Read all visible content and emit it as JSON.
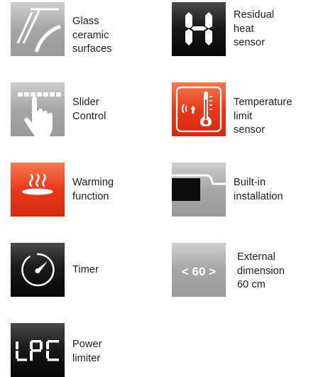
{
  "features": [
    {
      "id": "glass",
      "icon": "glass-ceramic-icon",
      "label": "Glass ceramic\nsurfaces"
    },
    {
      "id": "residual",
      "icon": "residual-heat-h-icon",
      "label": "Residual\nheat\nsensor"
    },
    {
      "id": "slider",
      "icon": "slider-finger-icon",
      "label": "Slider\nControl"
    },
    {
      "id": "templimit",
      "icon": "thermometer-icon",
      "label": "Temperature limit\nsensor"
    },
    {
      "id": "warming",
      "icon": "warming-plate-icon",
      "label": "Warming\nfunction"
    },
    {
      "id": "builtin",
      "icon": "built-in-installation-icon",
      "label": "Built-in\ninstallation"
    },
    {
      "id": "timer",
      "icon": "timer-dial-icon",
      "label": "Timer"
    },
    {
      "id": "dimension",
      "icon": "dimension-badge-icon",
      "label": "External\ndimension\n60 cm",
      "badge": "< 60 >"
    },
    {
      "id": "power",
      "icon": "lpc-display-icon",
      "label": "Power\nlimiter"
    }
  ],
  "colors": {
    "label_text": "#1c1c1c",
    "gray_tile": "#9e9e9e",
    "black_tile": "#0c0c0c",
    "red_tile": "#e8381a"
  }
}
